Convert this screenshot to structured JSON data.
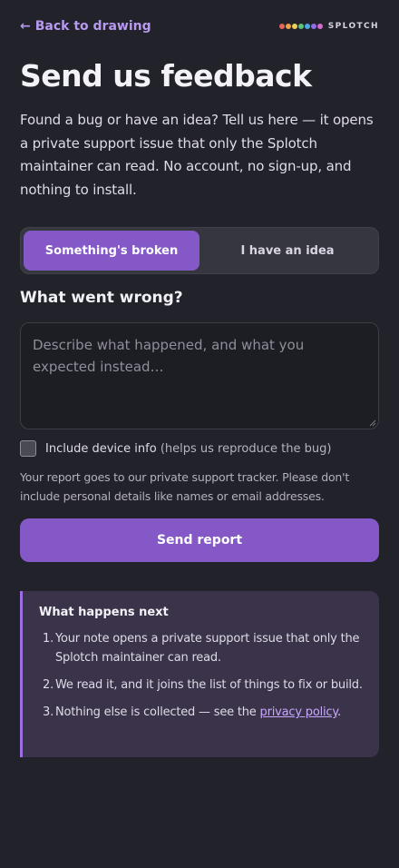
{
  "nav": {
    "back_label": "Back to drawing",
    "back_icon": "arrow-left-icon",
    "brand_name": "SPLOTCH",
    "brand_dot_colors": [
      "#e8635a",
      "#f0a24b",
      "#e9d45a",
      "#5cc47a",
      "#4aa8e8",
      "#8f6ee8",
      "#d46ad0"
    ]
  },
  "page": {
    "title": "Send us feedback",
    "intro": "Found a bug or have an idea? Tell us here — it opens a private support issue that only the Splotch maintainer can read. No account, no sign-up, and nothing to install."
  },
  "mode_toggle": {
    "options": [
      "Something's broken",
      "I have an idea"
    ],
    "selected": "Something's broken"
  },
  "form": {
    "section_title": "What went wrong?",
    "textarea_placeholder": "Describe what happened, and what you expected instead…",
    "textarea_value": "",
    "checkbox_label": "Include device info",
    "checkbox_hint": "(helps us reproduce the bug)",
    "checkbox_checked": false,
    "privacy_note": "Your report goes to our private support tracker. Please don't include personal details like names or email addresses.",
    "submit_label": "Send report"
  },
  "next_steps": {
    "title": "What happens next",
    "items": [
      "Your note opens a private support issue that only the Splotch maintainer can read.",
      "We read it, and it joins the list of things to fix or build.",
      "Nothing else is collected — see the"
    ],
    "item_numbers": [
      "1.",
      "2.",
      "3."
    ],
    "link_text": "privacy policy",
    "link_suffix": "."
  },
  "colors": {
    "background": "#22222a",
    "accent": "#8458c7",
    "link": "#b79af0",
    "card_background": "#3a3349",
    "card_border": "#9b6fe0"
  }
}
